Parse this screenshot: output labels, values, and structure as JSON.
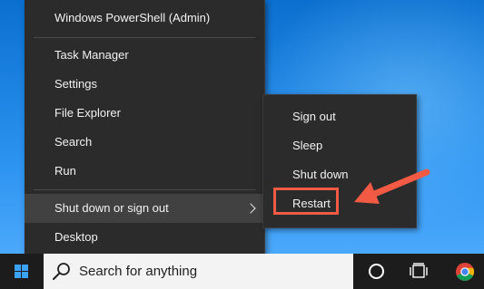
{
  "winx_menu": {
    "items": [
      {
        "label": "Windows PowerShell (Admin)"
      },
      {
        "label": "Task Manager"
      },
      {
        "label": "Settings"
      },
      {
        "label": "File Explorer"
      },
      {
        "label": "Search"
      },
      {
        "label": "Run"
      },
      {
        "label": "Shut down or sign out"
      },
      {
        "label": "Desktop"
      }
    ]
  },
  "submenu": {
    "items": [
      {
        "label": "Sign out"
      },
      {
        "label": "Sleep"
      },
      {
        "label": "Shut down"
      },
      {
        "label": "Restart"
      }
    ]
  },
  "taskbar": {
    "search_placeholder": "Search for anything"
  },
  "colors": {
    "menu_bg": "#2b2b2b",
    "highlight": "#414141",
    "annotation": "#f25a44",
    "taskbar": "#1c1c1c",
    "accent": "#3ba3ff"
  },
  "icons": [
    "windows-logo-icon",
    "search-icon",
    "cortana-icon",
    "task-view-icon",
    "chrome-icon",
    "chevron-right-icon",
    "annotation-arrow-icon"
  ]
}
